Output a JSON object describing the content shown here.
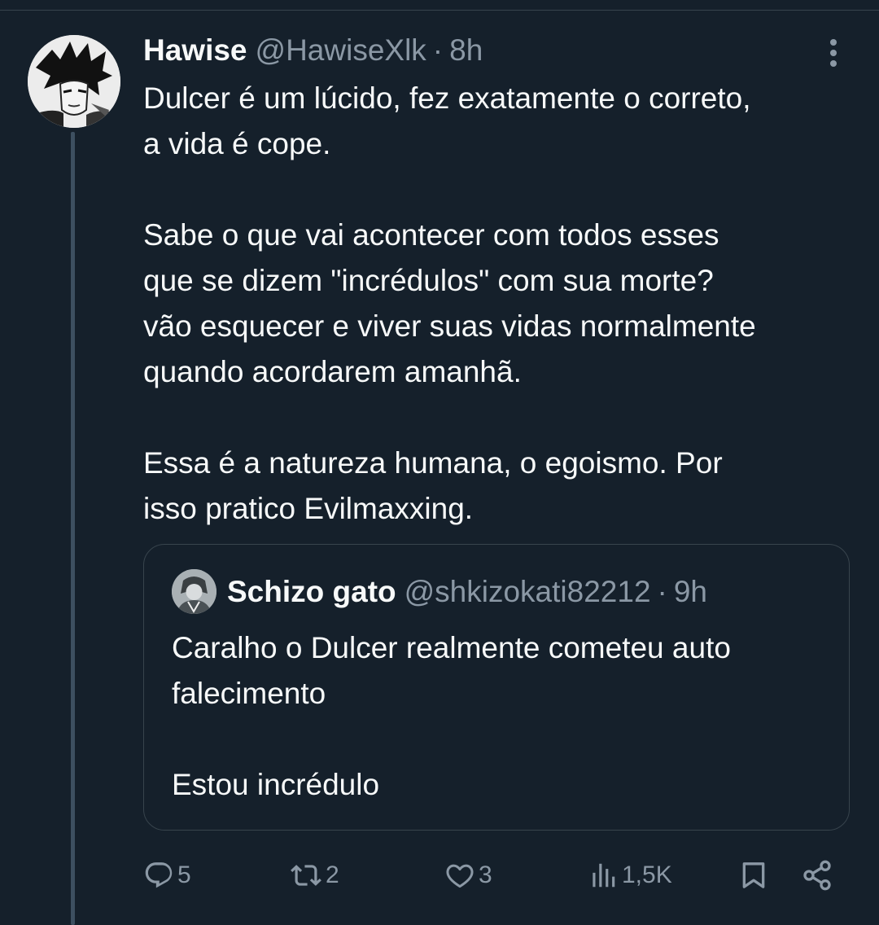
{
  "tweet": {
    "author": {
      "display_name": "Hawise",
      "handle": "@HawiseXlk",
      "separator": "·",
      "time": "8h"
    },
    "text": "Dulcer é um lúcido, fez exatamente o correto,\na vida é cope.\n\nSabe o que vai acontecer com todos esses\nque se dizem \"incrédulos\" com sua morte?\nvão esquecer e viver suas vidas normalmente\nquando acordarem amanhã.\n\nEssa é a natureza humana, o egoismo. Por\nisso pratico Evilmaxxing.",
    "more_icon": "more-vertical-icon"
  },
  "quoted_tweet": {
    "author": {
      "display_name": "Schizo gato",
      "handle": "@shkizokati82212",
      "separator": "·",
      "time": "9h"
    },
    "text": "Caralho o Dulcer realmente cometeu auto\nfalecimento\n\nEstou incrédulo"
  },
  "actions": {
    "reply": {
      "icon": "reply-icon",
      "count": "5"
    },
    "retweet": {
      "icon": "retweet-icon",
      "count": "2"
    },
    "like": {
      "icon": "heart-icon",
      "count": "3"
    },
    "views": {
      "icon": "views-icon",
      "count": "1,5K"
    },
    "bookmark": {
      "icon": "bookmark-icon"
    },
    "share": {
      "icon": "share-icon"
    }
  },
  "colors": {
    "background": "#15202b",
    "primary_text": "#f7f9f9",
    "secondary_text": "#8b98a5",
    "border": "#38444d",
    "thread_line": "#3d4f60"
  }
}
